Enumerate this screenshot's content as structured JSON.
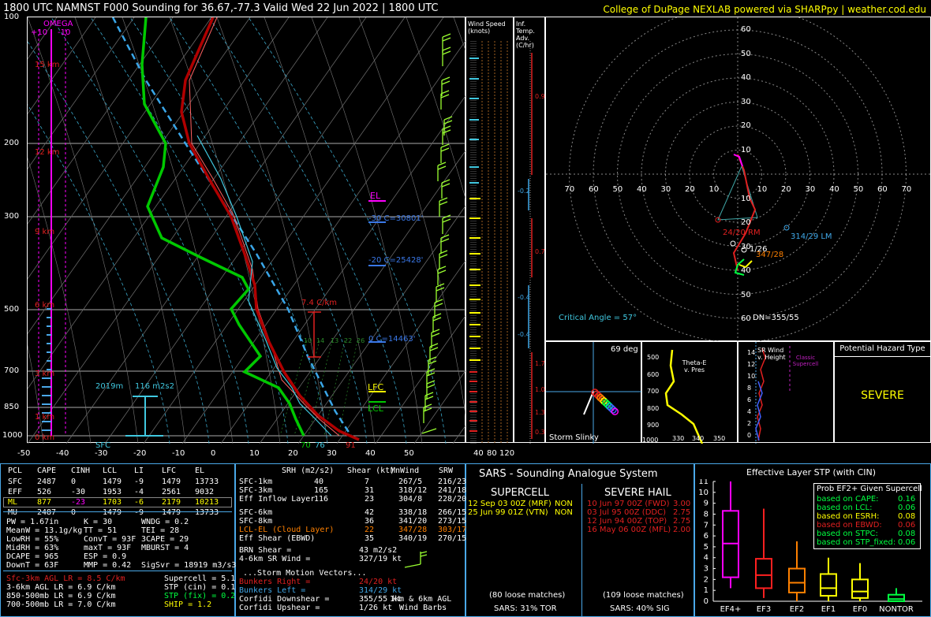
{
  "header": {
    "title": "1800 UTC NAMNST F000 Sounding for 36.67,-77.3 Valid  Wed 22 Jun 2022 | 1800 UTC",
    "credit": "College of DuPage NEXLAB powered via SHARPpy | weather.cod.edu"
  },
  "skewt": {
    "pressure_labels": [
      "100",
      "200",
      "300",
      "500",
      "700",
      "850",
      "1000"
    ],
    "temp_labels": [
      "-50",
      "-40",
      "-30",
      "-20",
      "-10",
      "0",
      "10",
      "20",
      "30",
      "40",
      "50"
    ],
    "height_labels": [
      "15 km",
      "12 km",
      "9 km",
      "6 km",
      "3 km",
      "1 km",
      "0 km"
    ],
    "omega_title": "OMEGA",
    "omega_plus": "+10",
    "omega_minus": "-10",
    "el_label": "EL",
    "lfc_label": "LFC",
    "lcl_label": "LCL",
    "iso_labels": [
      "-30 C=30801'",
      "-20 C=25428'",
      "0 C=14463'"
    ],
    "lapse_rate": "7.4 C/km",
    "mixing_ratios": [
      "10",
      "14",
      "13",
      "22",
      "26"
    ],
    "effective_inflow": "2019m",
    "effective_srh": "116 m2s2",
    "sfc_label": "SFC",
    "sfc_values": [
      "70",
      "76",
      "91"
    ]
  },
  "wind_panel": {
    "title": "Wind Speed (knots)",
    "axis": [
      "40",
      "80",
      "120"
    ]
  },
  "inf_temp": {
    "title": "Inf. Temp. Adv. (C/hr)",
    "values": [
      "0.9",
      "-0.2",
      "0.7",
      "-0.4",
      "-0.4",
      "1.7",
      "1.0",
      "1.3",
      "0.3"
    ]
  },
  "hodograph": {
    "rings": [
      "60",
      "50",
      "40",
      "30",
      "20",
      "10"
    ],
    "axis_left": [
      "70",
      "60",
      "50",
      "40",
      "30",
      "20",
      "10"
    ],
    "axis_right": [
      "10",
      "20",
      "30",
      "40",
      "50",
      "60",
      "70"
    ],
    "rings_lower": [
      "10",
      "20",
      "30",
      "40",
      "50",
      "60"
    ],
    "rm_label": "24/20 RM",
    "lm_label": "314/29 LM",
    "mean_label": "1/26",
    "mw_label": "347/28",
    "critical_angle": "Critical Angle = 57°",
    "dn_label": "DN=355/55"
  },
  "slinky": {
    "angle": "69 deg",
    "title": "Storm Slinky"
  },
  "theta": {
    "title": "Theta-E v. Pres",
    "pres": [
      "500",
      "600",
      "700",
      "800",
      "900",
      "1000"
    ],
    "x": [
      "330",
      "340",
      "350"
    ]
  },
  "srwind": {
    "title": "SR Wind v. Height",
    "heights": [
      "14",
      "12",
      "10",
      "8",
      "6",
      "4",
      "2",
      "0"
    ],
    "classic": "Classic Supercell"
  },
  "hazard": {
    "title": "Potential Hazard Type",
    "value": "SEVERE"
  },
  "parcels": {
    "headers": [
      "PCL",
      "CAPE",
      "CINH",
      "LCL",
      "LI",
      "LFC",
      "EL"
    ],
    "rows": [
      [
        "SFC",
        "2487",
        "0",
        "1479",
        "-9",
        "1479",
        "13733"
      ],
      [
        "EFF",
        "526",
        "-30",
        "1953",
        "-4",
        "2561",
        "9032"
      ],
      [
        "ML",
        "877",
        "-23",
        "1703",
        "-6",
        "2179",
        "10213"
      ],
      [
        "MU",
        "2487",
        "0",
        "1479",
        "-9",
        "1479",
        "13733"
      ]
    ]
  },
  "thermo": {
    "col1": [
      "PW = 1.67in",
      "MeanW = 13.1g/kg",
      "LowRH = 55%",
      "MidRH = 63%",
      "DCAPE = 965",
      "DownT = 63F"
    ],
    "col2": [
      "K = 30",
      "TT = 51",
      "ConvT = 93F",
      "maxT = 93F",
      "ESP = 0.9",
      "MMP = 0.42"
    ],
    "col3": [
      "WNDG = 0.2",
      "TEI = 28",
      "3CAPE = 29",
      "MBURST = 4",
      "",
      "SigSvr = 18919 m3/s3"
    ]
  },
  "lapse": [
    "Sfc-3km AGL LR = 8.5 C/km",
    "3-6km AGL LR = 6.9 C/km",
    "850-500mb LR = 6.9 C/km",
    "700-500mb LR = 7.0 C/km"
  ],
  "composites": [
    "Supercell = 5.1",
    "STP (cin) = 0.1",
    "STP (fix) = 0.2",
    "SHIP = 1.2"
  ],
  "kinematics": {
    "headers": [
      "SRH (m2/s2)",
      "Shear (kt)",
      "MnWind",
      "SRW"
    ],
    "rows": [
      [
        "SFC-1km",
        "40",
        "7",
        "267/5",
        "216/23"
      ],
      [
        "SFC-3km",
        "165",
        "31",
        "318/12",
        "241/18"
      ],
      [
        "Eff Inflow Layer",
        "116",
        "23",
        "304/8",
        "228/20"
      ],
      [
        "SFC-6km",
        "42",
        "338/18",
        "266/15",
        ""
      ],
      [
        "SFC-8km",
        "36",
        "341/20",
        "273/15",
        ""
      ],
      [
        "LCL-EL (Cloud Layer)",
        "22",
        "347/28",
        "303/17",
        ""
      ],
      [
        "Eff Shear (EBWD)",
        "35",
        "340/19",
        "270/15",
        ""
      ]
    ],
    "brn_shear": "BRN Shear =",
    "brn_shear_val": "43 m2/s2",
    "sr_wind": "4-6km SR Wind =",
    "sr_wind_val": "327/19 kt",
    "storm_vectors": "...Storm Motion Vectors...",
    "bunkers_right": "Bunkers Right =",
    "bunkers_right_val": "24/20 kt",
    "bunkers_left": "Bunkers Left =",
    "bunkers_left_val": "314/29 kt",
    "corfidi_down": "Corfidi Downshear =",
    "corfidi_down_val": "355/55 kt",
    "corfidi_up": "Corfidi Upshear =",
    "corfidi_up_val": "1/26 kt",
    "barbs_note1": "1km & 6km AGL",
    "barbs_note2": "Wind Barbs"
  },
  "sars": {
    "title": "SARS - Sounding Analogue System",
    "supercell_title": "SUPERCELL",
    "supercell": [
      [
        "12 Sep 03 00Z (MRF)",
        "NON"
      ],
      [
        "25 Jun 99 01Z (VTN)",
        "NON"
      ]
    ],
    "supercell_matches": "(80 loose matches)",
    "supercell_prob": "SARS: 31% TOR",
    "hail_title": "SEVERE HAIL",
    "hail": [
      [
        "10 Jun 97 00Z (FWD)",
        "3.00"
      ],
      [
        "03 Jul 95 00Z (DDC)",
        "2.75"
      ],
      [
        "12 Jun 94 00Z (TOP)",
        "2.75"
      ],
      [
        "16 May 06 00Z (MFL)",
        "2.00"
      ]
    ],
    "hail_matches": "(109 loose matches)",
    "hail_prob": "SARS: 40% SIG"
  },
  "stp_panel": {
    "title": "Effective Layer STP (with CIN)",
    "yticks": [
      "11",
      "10",
      "9",
      "8",
      "7",
      "6",
      "5",
      "4",
      "3",
      "2",
      "1",
      "0"
    ],
    "categories": [
      "EF4+",
      "EF3",
      "EF2",
      "EF1",
      "EF0",
      "NONTOR"
    ],
    "prob_title": "Prob EF2+ Given Supercell",
    "prob_rows": [
      [
        "based on CAPE:",
        "0.16"
      ],
      [
        "based on LCL:",
        "0.06"
      ],
      [
        "based on ESRH:",
        "0.08"
      ],
      [
        "based on EBWD:",
        "0.06"
      ],
      [
        "based on STPC:",
        "0.08"
      ],
      [
        "based on STP_fixed:",
        "0.06"
      ]
    ]
  },
  "chart_data": {
    "type": "box",
    "title": "Effective Layer STP (with CIN)",
    "categories": [
      "EF4+",
      "EF3",
      "EF2",
      "EF1",
      "EF0",
      "NONTOR"
    ],
    "box_stats": [
      {
        "min": 1.2,
        "q1": 2.2,
        "median": 5.3,
        "q3": 8.3,
        "max": 11.0
      },
      {
        "min": 0.3,
        "q1": 1.2,
        "median": 2.4,
        "q3": 3.9,
        "max": 8.5
      },
      {
        "min": 0.0,
        "q1": 0.8,
        "median": 1.7,
        "q3": 3.0,
        "max": 5.5
      },
      {
        "min": 0.0,
        "q1": 0.5,
        "median": 1.2,
        "q3": 2.5,
        "max": 4.0
      },
      {
        "min": 0.0,
        "q1": 0.3,
        "median": 0.9,
        "q3": 2.0,
        "max": 3.5
      },
      {
        "min": 0.0,
        "q1": 0.0,
        "median": 0.2,
        "q3": 0.6,
        "max": 1.2
      }
    ],
    "ylim": [
      0,
      11
    ],
    "colors": [
      "#ff00ff",
      "#ff2020",
      "#ff8000",
      "#ffff00",
      "#ffff00",
      "#00ff40"
    ]
  }
}
